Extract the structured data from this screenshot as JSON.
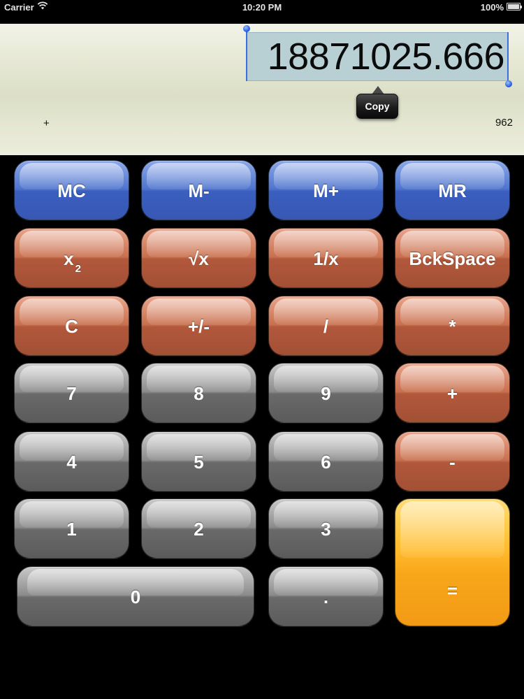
{
  "status_bar": {
    "carrier": "Carrier",
    "time": "10:20 PM",
    "battery": "100%"
  },
  "display": {
    "value": "18871025.666",
    "operation": "+",
    "memory": "962",
    "copy_label": "Copy"
  },
  "keys": {
    "mc": "MC",
    "m_minus": "M-",
    "m_plus": "M+",
    "mr": "MR",
    "x_squared_base": "x",
    "x_squared_exp": "2",
    "sqrt": "√x",
    "reciprocal": "1/x",
    "backspace": "BckSpace",
    "clear": "C",
    "plus_minus": "+/-",
    "divide": "/",
    "multiply": "*",
    "seven": "7",
    "eight": "8",
    "nine": "9",
    "plus": "+",
    "four": "4",
    "five": "5",
    "six": "6",
    "minus": "-",
    "one": "1",
    "two": "2",
    "three": "3",
    "equals": "=",
    "zero": "0",
    "decimal": "."
  },
  "colors": {
    "memory_keys": "#4f74cd",
    "function_keys": "#c8704f",
    "digit_keys": "#8b8b8b",
    "equals_key": "#ffbb2b"
  }
}
